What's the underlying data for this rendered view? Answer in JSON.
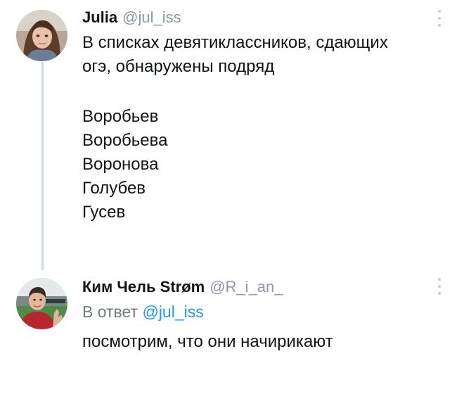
{
  "tweets": [
    {
      "author": {
        "display_name": "Julia",
        "handle": "@jul_iss",
        "avatar": "avatar-photo-woman"
      },
      "text_lines": [
        "В списках девятиклассников, сдающих",
        "огэ, обнаружены подряд",
        "",
        "Воробьев",
        "Воробьева",
        "Воронова",
        "Голубев",
        "Гусев"
      ],
      "menu_icon": "more-vertical-icon"
    },
    {
      "author": {
        "display_name": "Ким Чель Strøm",
        "handle": "@R_i_an_",
        "avatar": "avatar-photo-man"
      },
      "reply_prefix": "В ответ",
      "reply_handle": "@jul_iss",
      "text_lines": [
        "посмотрим, что они начирикают"
      ],
      "menu_icon": "more-vertical-icon"
    }
  ],
  "colors": {
    "text": "#0f1419",
    "secondary": "#8b98a5",
    "link": "#1d9bf0",
    "thread_line": "#cfd9de"
  }
}
